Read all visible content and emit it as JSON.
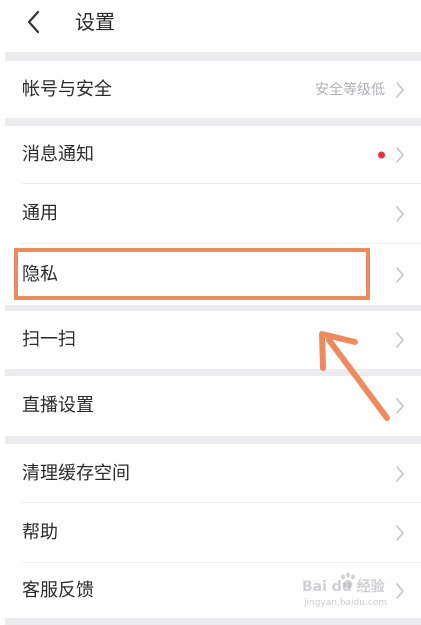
{
  "header": {
    "title": "设置"
  },
  "settings": {
    "account": {
      "label": "帐号与安全",
      "value": "安全等级低"
    },
    "notifications": {
      "label": "消息通知",
      "has_badge_dot": true
    },
    "general": {
      "label": "通用"
    },
    "privacy": {
      "label": "隐私"
    },
    "scan": {
      "label": "扫一扫"
    },
    "live": {
      "label": "直播设置"
    },
    "cache": {
      "label": "清理缓存空间"
    },
    "help": {
      "label": "帮助"
    },
    "feedback": {
      "label": "客服反馈"
    }
  },
  "colors": {
    "badge_dot": "#e5323c",
    "highlight": "#ef8a5d",
    "separator": "#ececee"
  },
  "watermark": {
    "brand": "Bai du 经验",
    "url": "jingyan.baidu.com"
  }
}
